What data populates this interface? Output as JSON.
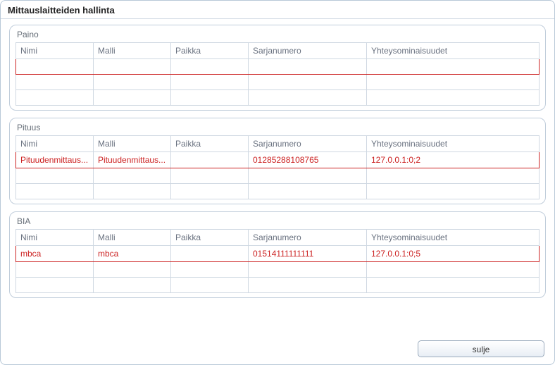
{
  "window_title": "Mittauslaitteiden hallinta",
  "columns": {
    "nimi": "Nimi",
    "malli": "Malli",
    "paikka": "Paikka",
    "sarjanumero": "Sarjanumero",
    "yhteys": "Yhteysominaisuudet"
  },
  "sections": {
    "paino": {
      "title": "Paino",
      "rows": [
        {
          "nimi": "",
          "malli": "",
          "paikka": "",
          "sarjanumero": "",
          "yhteys": "",
          "selected": true
        },
        {
          "nimi": "",
          "malli": "",
          "paikka": "",
          "sarjanumero": "",
          "yhteys": ""
        },
        {
          "nimi": "",
          "malli": "",
          "paikka": "",
          "sarjanumero": "",
          "yhteys": ""
        }
      ]
    },
    "pituus": {
      "title": "Pituus",
      "rows": [
        {
          "nimi": "Pituudenmittaus...",
          "malli": "Pituudenmittaus...",
          "paikka": "",
          "sarjanumero": "01285288108765",
          "yhteys": "127.0.0.1:0;2",
          "selected": true
        },
        {
          "nimi": "",
          "malli": "",
          "paikka": "",
          "sarjanumero": "",
          "yhteys": ""
        },
        {
          "nimi": "",
          "malli": "",
          "paikka": "",
          "sarjanumero": "",
          "yhteys": ""
        }
      ]
    },
    "bia": {
      "title": "BIA",
      "rows": [
        {
          "nimi": "mbca",
          "malli": "mbca",
          "paikka": "",
          "sarjanumero": "01514111111111",
          "yhteys": "127.0.0.1:0;5",
          "selected": true
        },
        {
          "nimi": "",
          "malli": "",
          "paikka": "",
          "sarjanumero": "",
          "yhteys": ""
        },
        {
          "nimi": "",
          "malli": "",
          "paikka": "",
          "sarjanumero": "",
          "yhteys": ""
        }
      ]
    }
  },
  "buttons": {
    "close": "sulje"
  }
}
